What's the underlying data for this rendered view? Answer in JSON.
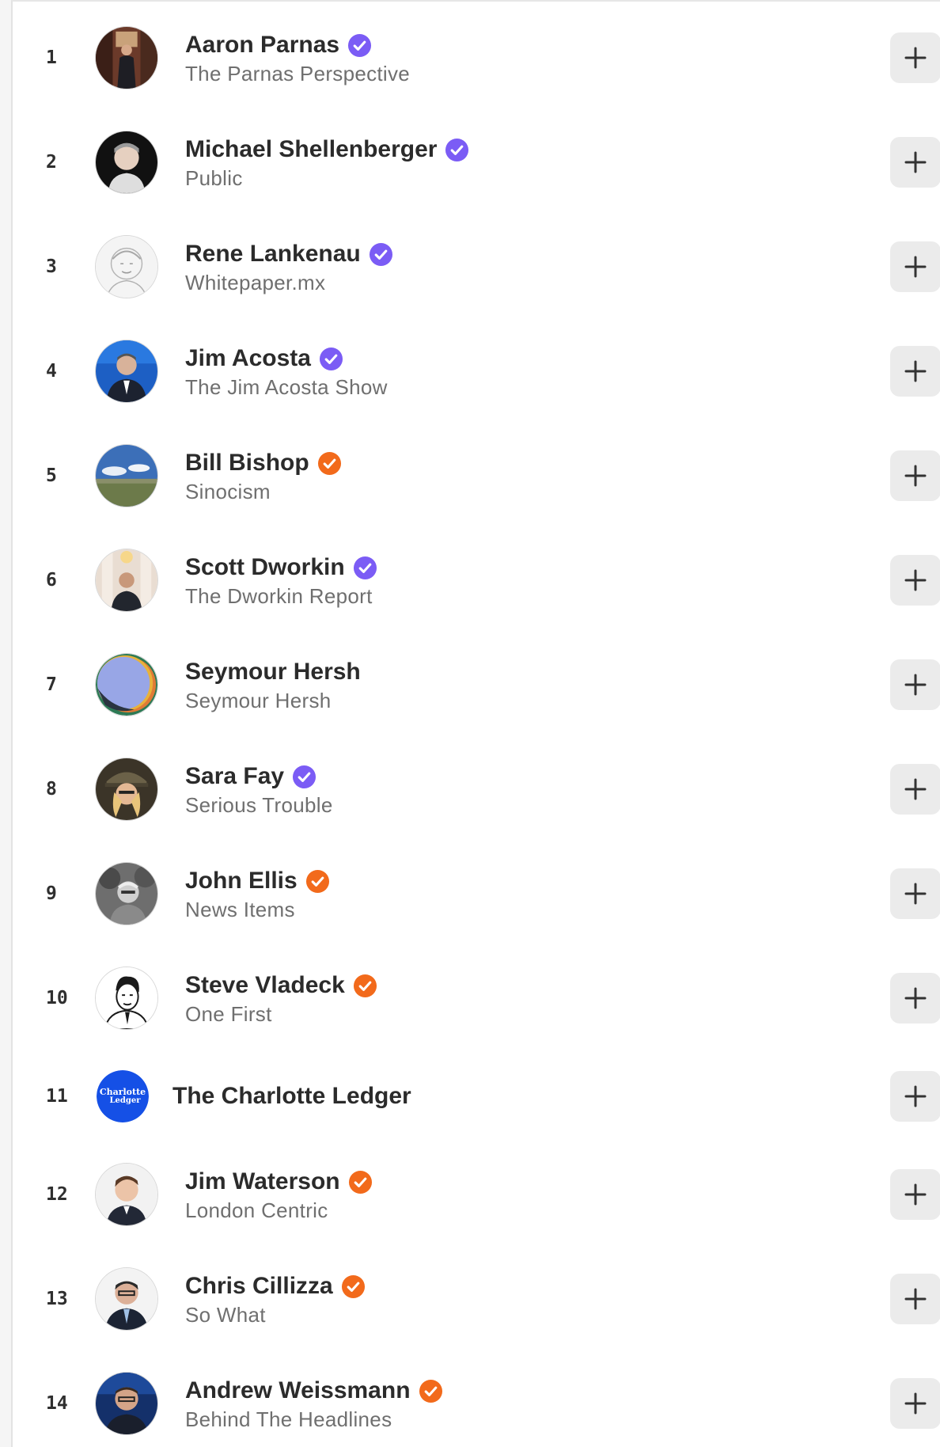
{
  "colors": {
    "verified_purple": "#7b5cf5",
    "verified_orange": "#f26a1b",
    "add_button_bg": "#ebebeb"
  },
  "icons": {
    "verified": "check-badge-icon",
    "add": "plus-icon"
  },
  "rows": [
    {
      "rank": "1",
      "name": "Aaron Parnas",
      "publication": "The Parnas Perspective",
      "badge": "purple"
    },
    {
      "rank": "2",
      "name": "Michael Shellenberger",
      "publication": "Public",
      "badge": "purple"
    },
    {
      "rank": "3",
      "name": "Rene Lankenau",
      "publication": "Whitepaper.mx",
      "badge": "purple"
    },
    {
      "rank": "4",
      "name": "Jim Acosta",
      "publication": "The Jim Acosta Show",
      "badge": "purple"
    },
    {
      "rank": "5",
      "name": "Bill Bishop",
      "publication": "Sinocism",
      "badge": "orange"
    },
    {
      "rank": "6",
      "name": "Scott Dworkin",
      "publication": "The Dworkin Report",
      "badge": "purple"
    },
    {
      "rank": "7",
      "name": "Seymour Hersh",
      "publication": "Seymour Hersh",
      "badge": "none"
    },
    {
      "rank": "8",
      "name": "Sara Fay",
      "publication": "Serious Trouble",
      "badge": "purple"
    },
    {
      "rank": "9",
      "name": "John Ellis",
      "publication": "News Items",
      "badge": "orange"
    },
    {
      "rank": "10",
      "name": "Steve Vladeck",
      "publication": "One First",
      "badge": "orange"
    },
    {
      "rank": "11",
      "name": "The Charlotte Ledger",
      "publication": "",
      "badge": "none",
      "logo_text": [
        "Charlotte",
        "Ledger"
      ]
    },
    {
      "rank": "12",
      "name": "Jim Waterson",
      "publication": "London Centric",
      "badge": "orange"
    },
    {
      "rank": "13",
      "name": "Chris Cillizza",
      "publication": "So What",
      "badge": "orange"
    },
    {
      "rank": "14",
      "name": "Andrew Weissmann",
      "publication": "Behind The Headlines",
      "badge": "orange"
    }
  ]
}
